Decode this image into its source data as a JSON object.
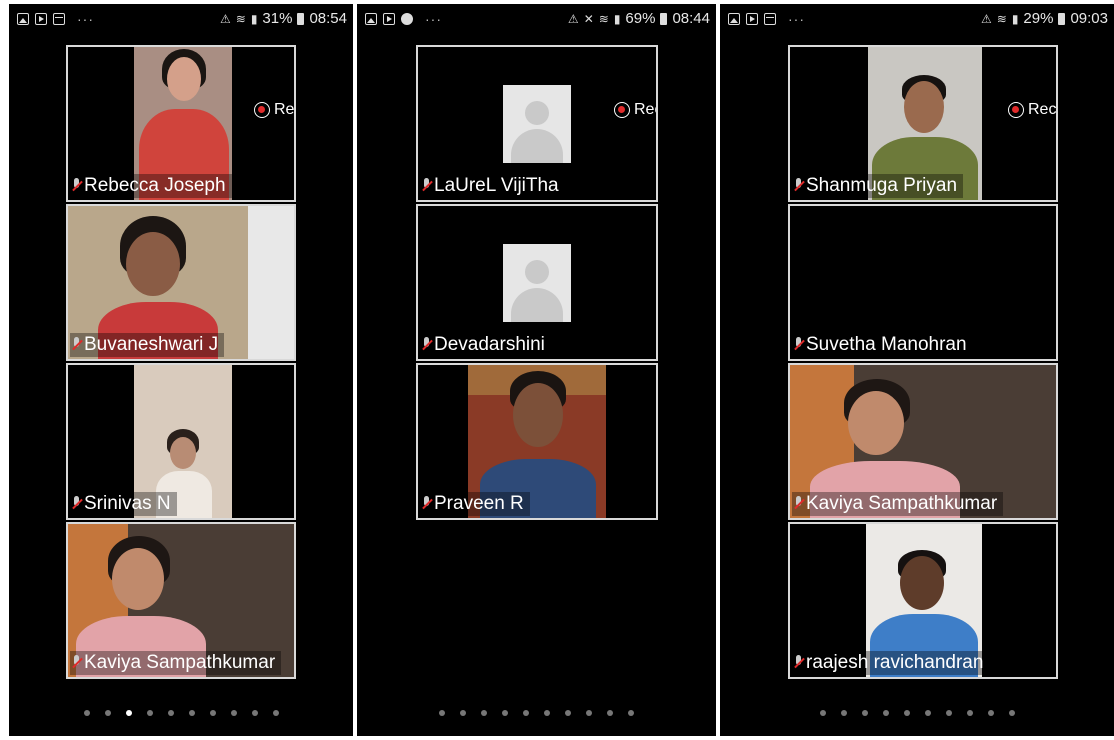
{
  "panels": [
    {
      "status": {
        "left_icons": [
          "image-icon",
          "video-icon",
          "calendar-icon"
        ],
        "overflow": "···",
        "battery": "31%",
        "time": "08:54"
      },
      "recording_label": "Recording",
      "participants": [
        "Rebecca Joseph",
        "Buvaneshwari J",
        "Srinivas N",
        "Kaviya Sampathkumar"
      ],
      "page_count": 10,
      "active_page": 3
    },
    {
      "status": {
        "left_icons": [
          "image-icon",
          "video-icon",
          "chrome-icon"
        ],
        "overflow": "···",
        "battery": "69%",
        "time": "08:44"
      },
      "recording_label": "Recording",
      "participants": [
        "LaUreL VijiTha",
        "Devadarshini",
        "Praveen R"
      ],
      "page_count": 10,
      "active_page": null
    },
    {
      "status": {
        "left_icons": [
          "image-icon",
          "video-icon",
          "calendar-icon"
        ],
        "overflow": "···",
        "battery": "29%",
        "time": "09:03"
      },
      "recording_label": "Recording",
      "participants": [
        "Shanmuga Priyan",
        "Suvetha Manohran",
        "Kaviya Sampathkumar",
        "raajesh ravichandran"
      ],
      "page_count": 10,
      "active_page": null
    }
  ],
  "colors": {
    "tile_border": "#d9d9d9",
    "record_red": "#e02a2a"
  }
}
